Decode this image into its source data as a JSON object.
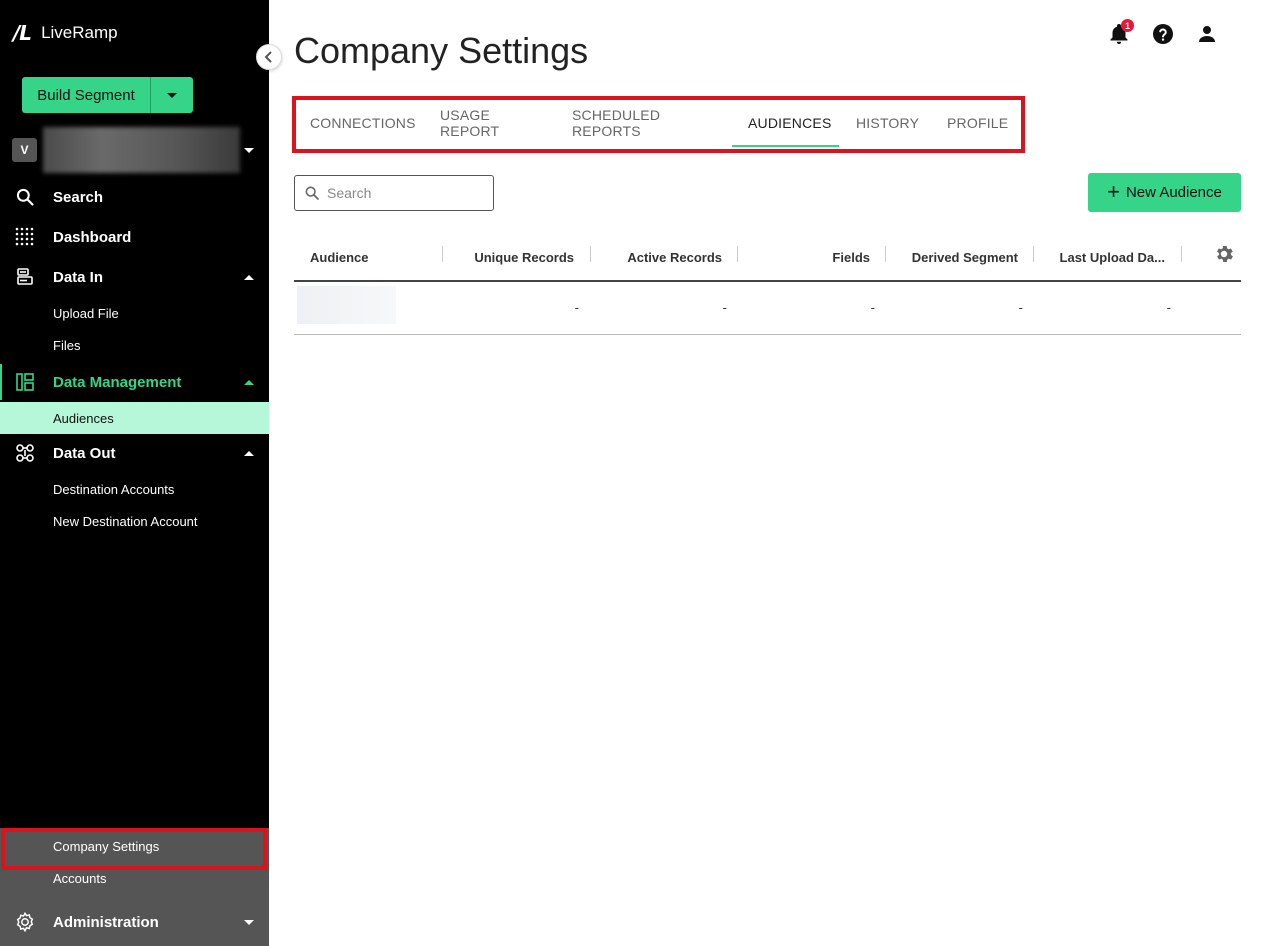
{
  "brand": {
    "mark": "/L",
    "name": "LiveRamp"
  },
  "sidebar": {
    "build_segment": "Build Segment",
    "account_badge": "V",
    "nav": {
      "search": "Search",
      "dashboard": "Dashboard",
      "data_in": "Data In",
      "upload_file": "Upload File",
      "files": "Files",
      "data_management": "Data Management",
      "audiences": "Audiences",
      "data_out": "Data Out",
      "destination_accounts": "Destination Accounts",
      "new_destination_account": "New Destination Account",
      "company_settings": "Company Settings",
      "accounts": "Accounts",
      "administration": "Administration"
    },
    "accent_color": "#35d488"
  },
  "header": {
    "title": "Company Settings",
    "notification_count": "1"
  },
  "tabs": [
    "CONNECTIONS",
    "USAGE REPORT",
    "SCHEDULED REPORTS",
    "AUDIENCES",
    "HISTORY",
    "PROFILE"
  ],
  "active_tab": "AUDIENCES",
  "search": {
    "placeholder": "Search",
    "value": ""
  },
  "new_audience_label": "New Audience",
  "table": {
    "columns": [
      "Audience",
      "Unique Records",
      "Active Records",
      "Fields",
      "Derived Segment",
      "Last Upload Da..."
    ],
    "rows": [
      {
        "audience": "",
        "unique_records": "-",
        "active_records": "-",
        "fields": "-",
        "derived_segment": "-",
        "last_upload": "-"
      }
    ]
  }
}
